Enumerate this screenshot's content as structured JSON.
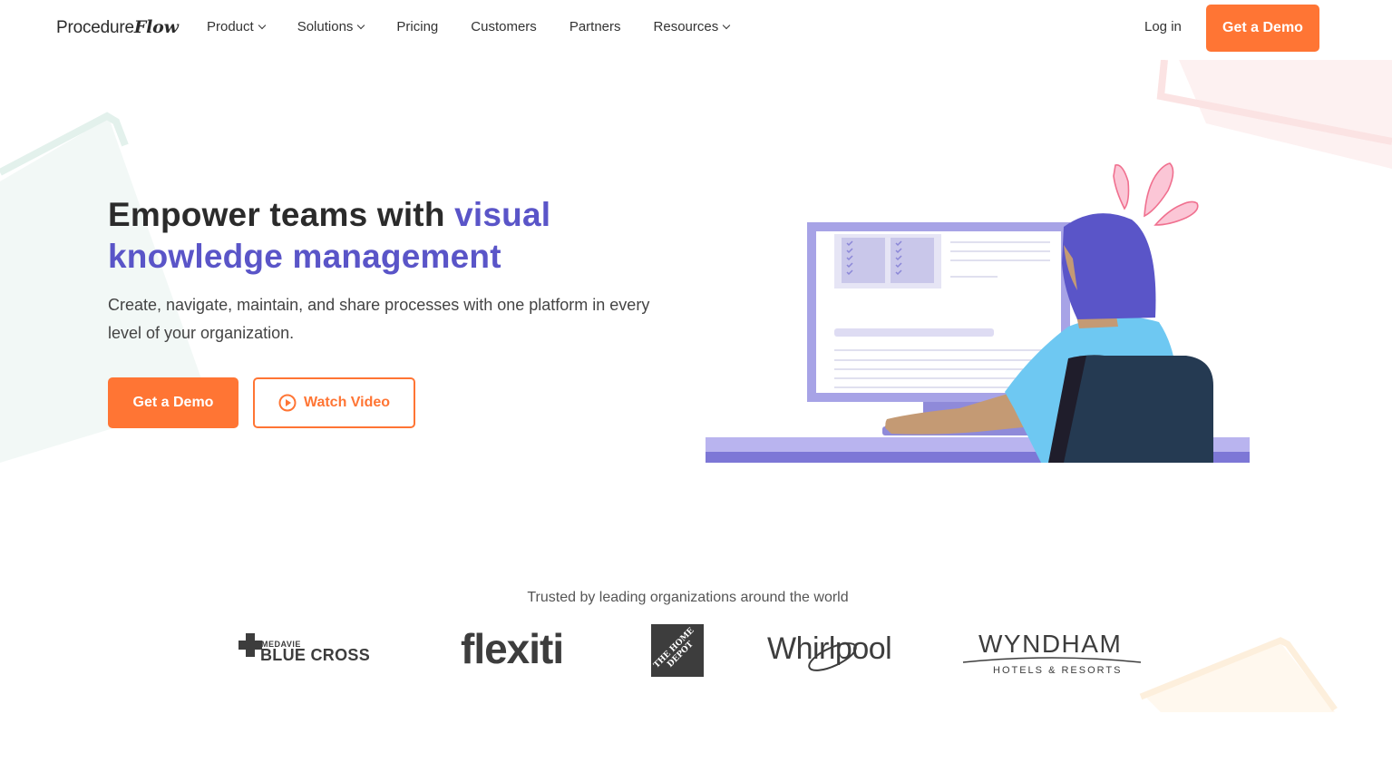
{
  "nav": {
    "logo_main": "Procedure",
    "logo_script": "Flow",
    "links": [
      {
        "label": "Product",
        "dropdown": true
      },
      {
        "label": "Solutions",
        "dropdown": true
      },
      {
        "label": "Pricing",
        "dropdown": false
      },
      {
        "label": "Customers",
        "dropdown": false
      },
      {
        "label": "Partners",
        "dropdown": false
      },
      {
        "label": "Resources",
        "dropdown": true
      }
    ],
    "login_label": "Log in",
    "demo_label": "Get a Demo"
  },
  "hero": {
    "title_plain": "Empower teams with ",
    "title_accent_1": "visual",
    "title_accent_2": "knowledge management",
    "subtitle": "Create, navigate, maintain, and share processes with one platform in every level of your organization.",
    "primary_label": "Get a Demo",
    "secondary_label": "Watch Video"
  },
  "trusted": {
    "heading": "Trusted by leading organizations around the world",
    "logos": [
      {
        "name": "medavie-blue-cross",
        "small": "MEDAVIE",
        "big": "BLUE CROSS"
      },
      {
        "name": "flexiti",
        "text": "flexiti"
      },
      {
        "name": "home-depot",
        "text": "THE HOME DEPOT"
      },
      {
        "name": "whirlpool",
        "text": "Whirlpool"
      },
      {
        "name": "wyndham",
        "big": "WYNDHAM",
        "small": "HOTELS & RESORTS"
      }
    ]
  },
  "colors": {
    "accent_orange": "#ff7534",
    "accent_purple": "#5a55c8",
    "text_dark": "#2b2b2b"
  }
}
